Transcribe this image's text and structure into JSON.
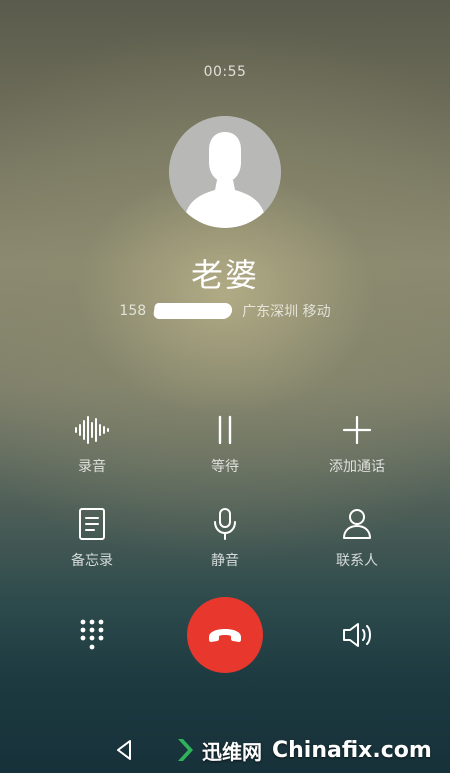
{
  "call": {
    "duration": "00:55",
    "contact_name": "老婆",
    "number_prefix": "158",
    "location": "广东深圳 移动"
  },
  "actions": [
    {
      "label": "录音",
      "icon": "waveform-icon"
    },
    {
      "label": "等待",
      "icon": "pause-icon"
    },
    {
      "label": "添加通话",
      "icon": "plus-icon"
    },
    {
      "label": "备忘录",
      "icon": "notes-icon"
    },
    {
      "label": "静音",
      "icon": "microphone-icon"
    },
    {
      "label": "联系人",
      "icon": "person-icon"
    }
  ],
  "controls": {
    "dialpad_icon": "dialpad-icon",
    "hangup_icon": "hang-up-phone-icon",
    "speaker_icon": "speaker-icon",
    "hangup_color": "#e8382e"
  },
  "navbar": {
    "back_icon": "back-triangle-icon"
  },
  "watermark": {
    "brand": "迅维网",
    "site": "Chinafix.com"
  }
}
